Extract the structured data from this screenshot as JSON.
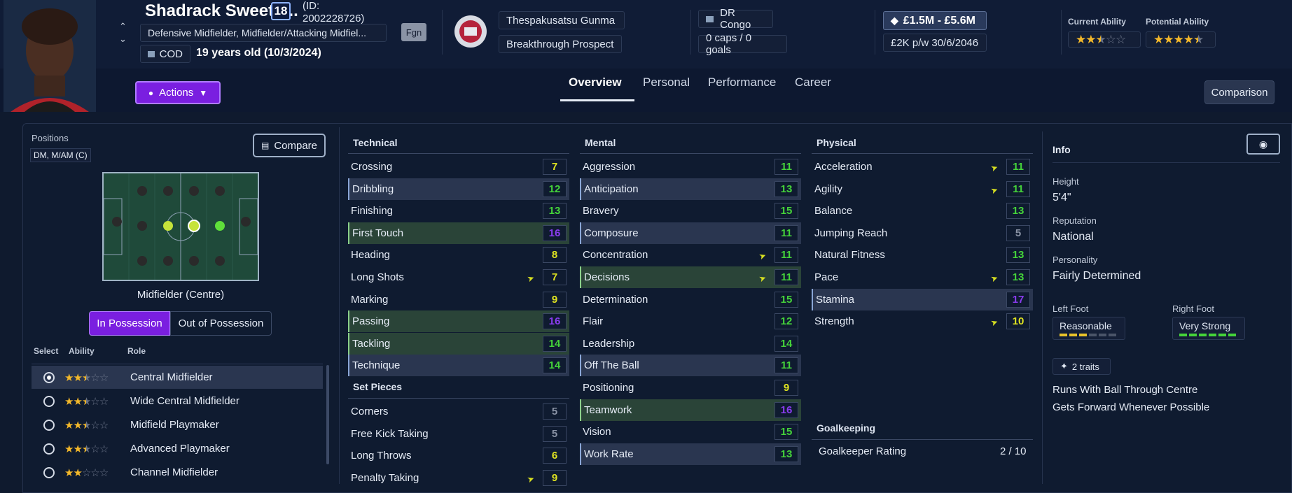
{
  "player": {
    "name": "Shadrack Sweetb...",
    "number": "18",
    "id_line1": "(ID:",
    "id_line2": "2002228726)",
    "positions_full": "Defensive Midfielder, Midfielder/Attacking Midfiel...",
    "fgn_badge": "Fgn",
    "nation_code": "COD",
    "age": "19 years old (10/3/2024)"
  },
  "club": {
    "name": "Thespakusatsu Gunma",
    "status": "Breakthrough Prospect"
  },
  "nation": {
    "name": "DR Congo",
    "caps": "0 caps / 0 goals"
  },
  "value": {
    "range": "£1.5M - £5.6M",
    "wage": "£2K p/w 30/6/2046"
  },
  "ability": {
    "current_label": "Current Ability",
    "potential_label": "Potential Ability",
    "current_stars": 2.5,
    "potential_stars": 4.5
  },
  "actions_label": "Actions",
  "tabs": [
    "Overview",
    "Personal",
    "Performance",
    "Career"
  ],
  "comparison_label": "Comparison",
  "positions_panel": {
    "title": "Positions",
    "short": "DM, M/AM (C)",
    "compare_label": "Compare",
    "pitch_caption": "Midfielder (Centre)",
    "in_possession": "In Possession",
    "out_possession": "Out of Possession",
    "col_select": "Select",
    "col_ability": "Ability",
    "col_role": "Role",
    "roles": [
      {
        "name": "Central Midfielder",
        "stars": 2.5
      },
      {
        "name": "Wide Central Midfielder",
        "stars": 2.5
      },
      {
        "name": "Midfield Playmaker",
        "stars": 2.5
      },
      {
        "name": "Advanced Playmaker",
        "stars": 2.5
      },
      {
        "name": "Channel Midfielder",
        "stars": 2
      }
    ]
  },
  "technical": {
    "title": "Technical",
    "attrs": [
      {
        "name": "Crossing",
        "value": "7",
        "color": "yellow"
      },
      {
        "name": "Dribbling",
        "value": "12",
        "color": "green",
        "hl": "blue"
      },
      {
        "name": "Finishing",
        "value": "13",
        "color": "green"
      },
      {
        "name": "First Touch",
        "value": "16",
        "color": "purple",
        "hl": "green"
      },
      {
        "name": "Heading",
        "value": "8",
        "color": "yellow"
      },
      {
        "name": "Long Shots",
        "value": "7",
        "color": "yellow",
        "arrow": true
      },
      {
        "name": "Marking",
        "value": "9",
        "color": "yellow"
      },
      {
        "name": "Passing",
        "value": "16",
        "color": "purple",
        "hl": "green"
      },
      {
        "name": "Tackling",
        "value": "14",
        "color": "green",
        "hl": "green"
      },
      {
        "name": "Technique",
        "value": "14",
        "color": "green",
        "hl": "blue"
      }
    ]
  },
  "set_pieces": {
    "title": "Set Pieces",
    "attrs": [
      {
        "name": "Corners",
        "value": "5",
        "color": "grey"
      },
      {
        "name": "Free Kick Taking",
        "value": "5",
        "color": "grey"
      },
      {
        "name": "Long Throws",
        "value": "6",
        "color": "yellow"
      },
      {
        "name": "Penalty Taking",
        "value": "9",
        "color": "yellow",
        "arrow": true
      }
    ]
  },
  "mental": {
    "title": "Mental",
    "attrs": [
      {
        "name": "Aggression",
        "value": "11",
        "color": "green"
      },
      {
        "name": "Anticipation",
        "value": "13",
        "color": "green",
        "hl": "blue"
      },
      {
        "name": "Bravery",
        "value": "15",
        "color": "green"
      },
      {
        "name": "Composure",
        "value": "11",
        "color": "green",
        "hl": "blue"
      },
      {
        "name": "Concentration",
        "value": "11",
        "color": "green",
        "arrow": true
      },
      {
        "name": "Decisions",
        "value": "11",
        "color": "green",
        "hl": "green",
        "arrow": true
      },
      {
        "name": "Determination",
        "value": "15",
        "color": "green"
      },
      {
        "name": "Flair",
        "value": "12",
        "color": "green"
      },
      {
        "name": "Leadership",
        "value": "14",
        "color": "green"
      },
      {
        "name": "Off The Ball",
        "value": "11",
        "color": "green",
        "hl": "blue"
      },
      {
        "name": "Positioning",
        "value": "9",
        "color": "yellow"
      },
      {
        "name": "Teamwork",
        "value": "16",
        "color": "purple",
        "hl": "green"
      },
      {
        "name": "Vision",
        "value": "15",
        "color": "green"
      },
      {
        "name": "Work Rate",
        "value": "13",
        "color": "green",
        "hl": "blue"
      }
    ]
  },
  "physical": {
    "title": "Physical",
    "attrs": [
      {
        "name": "Acceleration",
        "value": "11",
        "color": "green",
        "arrow": true
      },
      {
        "name": "Agility",
        "value": "11",
        "color": "green",
        "arrow": true
      },
      {
        "name": "Balance",
        "value": "13",
        "color": "green"
      },
      {
        "name": "Jumping Reach",
        "value": "5",
        "color": "grey"
      },
      {
        "name": "Natural Fitness",
        "value": "13",
        "color": "green"
      },
      {
        "name": "Pace",
        "value": "13",
        "color": "green",
        "arrow": true
      },
      {
        "name": "Stamina",
        "value": "17",
        "color": "purple",
        "hl": "blue"
      },
      {
        "name": "Strength",
        "value": "10",
        "color": "yellow",
        "arrow": true
      }
    ]
  },
  "goalkeeping": {
    "title": "Goalkeeping",
    "rating_label": "Goalkeeper Rating",
    "rating_value": "2 / 10"
  },
  "info": {
    "title": "Info",
    "height_label": "Height",
    "height": "5'4\"",
    "reputation_label": "Reputation",
    "reputation": "National",
    "personality_label": "Personality",
    "personality": "Fairly Determined",
    "left_foot_label": "Left Foot",
    "left_foot": "Reasonable",
    "left_foot_level": 3,
    "right_foot_label": "Right Foot",
    "right_foot": "Very Strong",
    "right_foot_level": 6,
    "traits_count": "2 traits",
    "traits": [
      "Runs With Ball Through Centre",
      "Gets Forward Whenever Possible"
    ]
  },
  "colors": {
    "yellow": "#dfe321",
    "green": "#45d43a",
    "purple": "#8a3cf0",
    "grey": "#8a93a5",
    "accent": "#7a1fe0"
  }
}
